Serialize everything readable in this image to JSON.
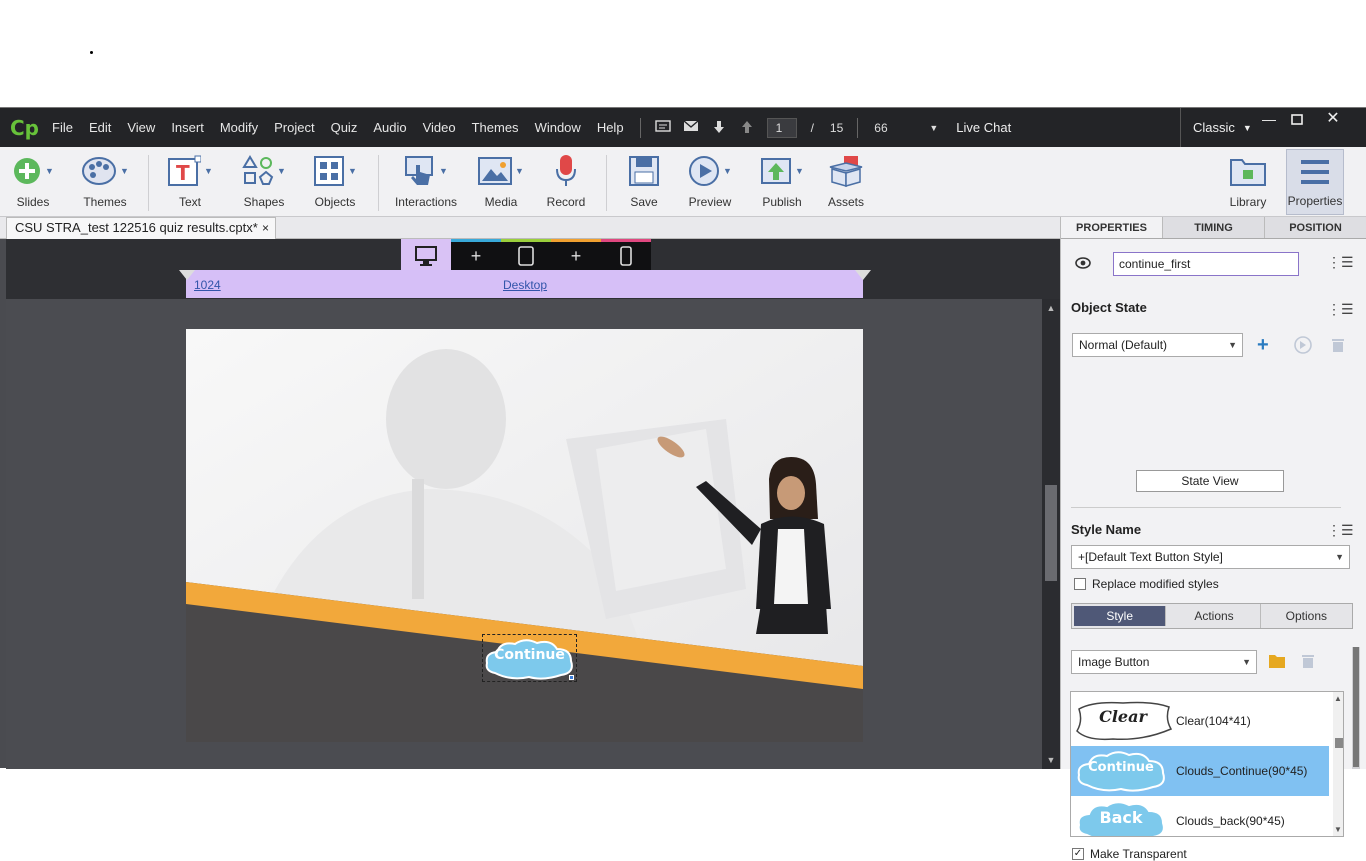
{
  "menubar": {
    "logo": "Cp",
    "items": [
      "File",
      "Edit",
      "View",
      "Insert",
      "Modify",
      "Project",
      "Quiz",
      "Audio",
      "Video",
      "Themes",
      "Window",
      "Help"
    ],
    "current_slide": "1",
    "slash": "/",
    "total_slides": "15",
    "zoom": "66",
    "live_chat": "Live Chat",
    "workspace": "Classic"
  },
  "toolbar": {
    "slides": "Slides",
    "themes": "Themes",
    "text": "Text",
    "shapes": "Shapes",
    "objects": "Objects",
    "interactions": "Interactions",
    "media": "Media",
    "record": "Record",
    "save": "Save",
    "preview": "Preview",
    "publish": "Publish",
    "assets": "Assets",
    "library": "Library",
    "properties": "Properties"
  },
  "document": {
    "tab_title": "CSU STRA_test 122516 quiz results.cptx*",
    "close": "×"
  },
  "stage": {
    "ruler_width": "1024",
    "breakpoint_name": "Desktop",
    "button_label": "Continue"
  },
  "panel": {
    "tabs": [
      "PROPERTIES",
      "TIMING",
      "POSITION"
    ],
    "object_name": "continue_first",
    "object_state_title": "Object State",
    "object_state_value": "Normal (Default)",
    "state_view": "State View",
    "style_name_title": "Style Name",
    "style_name_value": "+[Default Text Button Style]",
    "replace_modified": "Replace modified styles",
    "seg_tabs": [
      "Style",
      "Actions",
      "Options"
    ],
    "button_type": "Image Button",
    "list": [
      {
        "preview": "Clear",
        "label": "Clear(104*41)"
      },
      {
        "preview": "Continue",
        "label": "Clouds_Continue(90*45)"
      },
      {
        "preview": "Back",
        "label": "Clouds_back(90*45)"
      }
    ],
    "make_transparent": "Make Transparent"
  },
  "colors": {
    "menubar_bg": "#232427",
    "accent_purple": "#d9c2f5",
    "selected_row": "#80c1f2",
    "orange_band": "#f2a83b",
    "segment_active": "#4f5877"
  }
}
